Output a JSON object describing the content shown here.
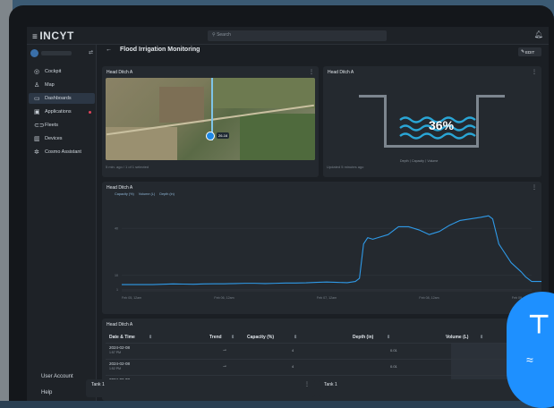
{
  "app": {
    "brand": "INCYT",
    "search_placeholder": "Search"
  },
  "org": {
    "name": ""
  },
  "sidebar": {
    "items": [
      {
        "label": "Cockpit",
        "icon": "cockpit-icon",
        "glyph": "◎"
      },
      {
        "label": "Map",
        "icon": "map-icon",
        "glyph": "♙"
      },
      {
        "label": "Dashboards",
        "icon": "dashboard-icon",
        "glyph": "▭",
        "active": true
      },
      {
        "label": "Applications",
        "icon": "applications-icon",
        "glyph": "▣",
        "badge": true
      },
      {
        "label": "Fleets",
        "icon": "fleets-icon",
        "glyph": "⊂⊃"
      },
      {
        "label": "Devices",
        "icon": "devices-icon",
        "glyph": "▥"
      },
      {
        "label": "Cosmo Assistant",
        "icon": "assistant-icon",
        "glyph": "✲"
      }
    ],
    "user_account": "User Account",
    "help": "Help"
  },
  "page": {
    "title": "Flood Irrigation Monitoring",
    "edit_label": "EDIT"
  },
  "map_card": {
    "title": "Head Ditch A",
    "pin_label": "26-16",
    "footer": "5 min. ago / 1 of 1 selected"
  },
  "ditch_card": {
    "title": "Head Ditch A",
    "capacity_pct": "36%",
    "capacity_value": 0.36,
    "legend": "Depth    ⟨  Capacity  ⟩   Volume",
    "footer": "Updated 5 minutes ago"
  },
  "chart_card": {
    "title": "Head Ditch A"
  },
  "table_card": {
    "title": "Head Ditch A",
    "columns": [
      "Date & Time",
      "Trend",
      "Capacity (%)",
      "Depth (in)",
      "Volume (L)"
    ],
    "rows": [
      {
        "date": "2024-02-08",
        "time": "1:57 PM",
        "trend": "→",
        "capacity": "4",
        "depth": "0.01"
      },
      {
        "date": "2024-02-08",
        "time": "1:52 PM",
        "trend": "→",
        "capacity": "4",
        "depth": "0.01"
      },
      {
        "date": "2024-02-08",
        "time": "1:47 PM",
        "trend": "→",
        "capacity": "4",
        "depth": "0.01"
      }
    ]
  },
  "tank_cards": [
    "Tank 1",
    "Tank 1"
  ],
  "colors": {
    "accent": "#1e88e5",
    "line": "#2f9ae8",
    "danger": "#e0435a"
  },
  "chart_data": {
    "type": "line",
    "title": "Head Ditch A",
    "legend": [
      "Capacity (%)",
      "Volume (L)",
      "Depth (in)"
    ],
    "x": [
      "Feb 05, 12am",
      "Feb 06, 12am",
      "Feb 07, 12am",
      "Feb 08, 12am",
      "Feb 09, 12am"
    ],
    "y_ticks": [
      "1",
      "10",
      "40"
    ],
    "ylim": [
      0,
      55
    ],
    "series": [
      {
        "name": "Capacity (%)",
        "values": [
          [
            0,
            4
          ],
          [
            0.1,
            4
          ],
          [
            0.2,
            4
          ],
          [
            0.3,
            4
          ],
          [
            0.4,
            4.2
          ],
          [
            0.5,
            4.4
          ],
          [
            0.6,
            4.3
          ],
          [
            0.7,
            4.2
          ],
          [
            0.8,
            4.4
          ],
          [
            0.9,
            4.5
          ],
          [
            1.0,
            4.5
          ],
          [
            1.1,
            4.6
          ],
          [
            1.2,
            4.8
          ],
          [
            1.3,
            4.8
          ],
          [
            1.4,
            4.6
          ],
          [
            1.5,
            4.8
          ],
          [
            1.6,
            5
          ],
          [
            1.7,
            5
          ],
          [
            1.8,
            5.1
          ],
          [
            1.9,
            5.4
          ],
          [
            2.0,
            5.6
          ],
          [
            2.1,
            5.4
          ],
          [
            2.2,
            5.2
          ],
          [
            2.28,
            6
          ],
          [
            2.32,
            8
          ],
          [
            2.36,
            30
          ],
          [
            2.4,
            34
          ],
          [
            2.45,
            33
          ],
          [
            2.5,
            34
          ],
          [
            2.6,
            36
          ],
          [
            2.7,
            41
          ],
          [
            2.8,
            41
          ],
          [
            2.9,
            39
          ],
          [
            3.0,
            36
          ],
          [
            3.1,
            38
          ],
          [
            3.2,
            42
          ],
          [
            3.3,
            45
          ],
          [
            3.4,
            46
          ],
          [
            3.5,
            47
          ],
          [
            3.58,
            48
          ],
          [
            3.62,
            46
          ],
          [
            3.68,
            30
          ],
          [
            3.72,
            26
          ],
          [
            3.8,
            18
          ],
          [
            3.9,
            12
          ],
          [
            3.94,
            9
          ],
          [
            4.0,
            6
          ],
          [
            4.1,
            6
          ],
          [
            4.2,
            5
          ],
          [
            4.3,
            4
          ]
        ]
      }
    ]
  }
}
